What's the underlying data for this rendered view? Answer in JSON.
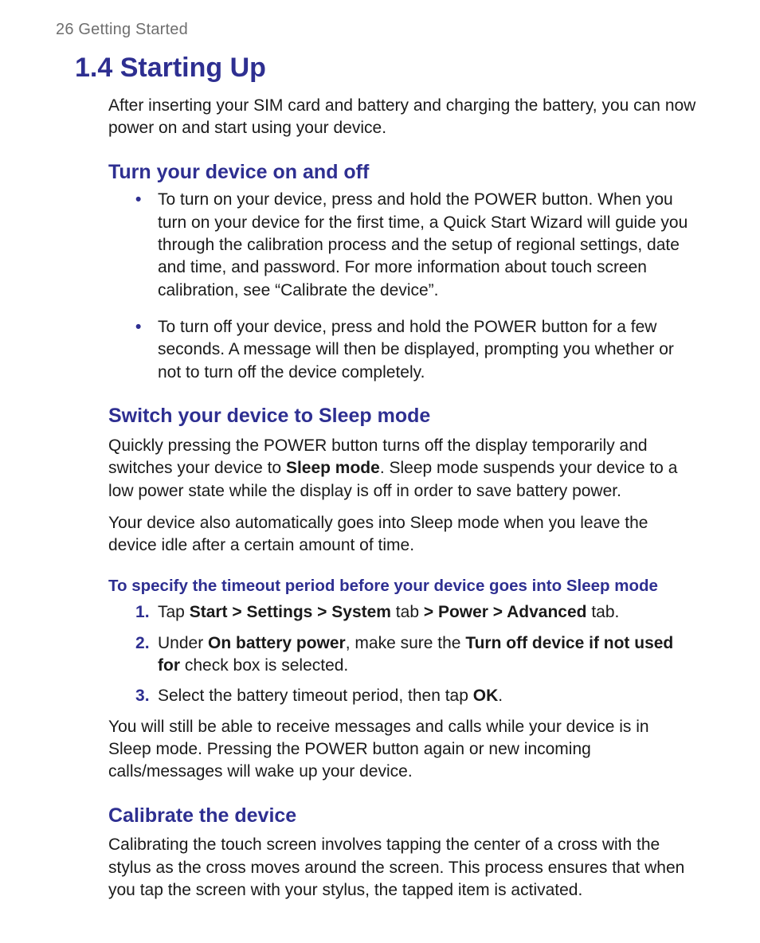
{
  "running_head": {
    "page_number": "26",
    "chapter": "Getting Started"
  },
  "h1": "1.4 Starting Up",
  "intro": "After inserting your SIM card and battery and charging the battery, you can now power on and start using your device.",
  "section_on_off": {
    "title": "Turn your device on and off",
    "bullet1": "To turn on your device, press and hold the POWER button. When you turn on your device for the first time, a Quick Start Wizard will guide you through the calibration process and the setup of regional settings, date and time, and password. For more information about touch screen calibration, see “Calibrate the device”.",
    "bullet2": "To turn off your device, press and hold the POWER button for a few seconds. A message will then be displayed, prompting you whether or not to turn off the device completely."
  },
  "section_sleep": {
    "title": "Switch your device to Sleep mode",
    "p1_a": "Quickly pressing the POWER button turns off the display temporarily and switches your device to ",
    "p1_bold": "Sleep mode",
    "p1_b": ". Sleep mode suspends your device to a low power state while the display is off in order to save battery power.",
    "p2": "Your device also automatically goes into Sleep mode when you leave the device idle after a certain amount of time.",
    "proc_title": "To specify the timeout period before your device goes into Sleep mode",
    "step1_a": "Tap ",
    "step1_bold": "Start > Settings > System",
    "step1_b": " tab ",
    "step1_bold2": "> Power > Advanced",
    "step1_c": " tab.",
    "step2_a": "Under ",
    "step2_bold1": "On battery power",
    "step2_b": ", make sure the ",
    "step2_bold2": "Turn off device if not used for",
    "step2_c": " check box is selected.",
    "step3_a": "Select the battery timeout period, then tap ",
    "step3_bold": "OK",
    "step3_b": ".",
    "p3": "You will still be able to receive messages and calls while your device is in Sleep mode. Pressing the POWER button again or new incoming calls/messages will wake up your device."
  },
  "section_calibrate": {
    "title": "Calibrate the device",
    "p1": "Calibrating the touch screen involves tapping the center of a cross with the stylus as the cross moves around the screen. This process ensures that when you tap the screen with your stylus, the tapped item is activated."
  }
}
